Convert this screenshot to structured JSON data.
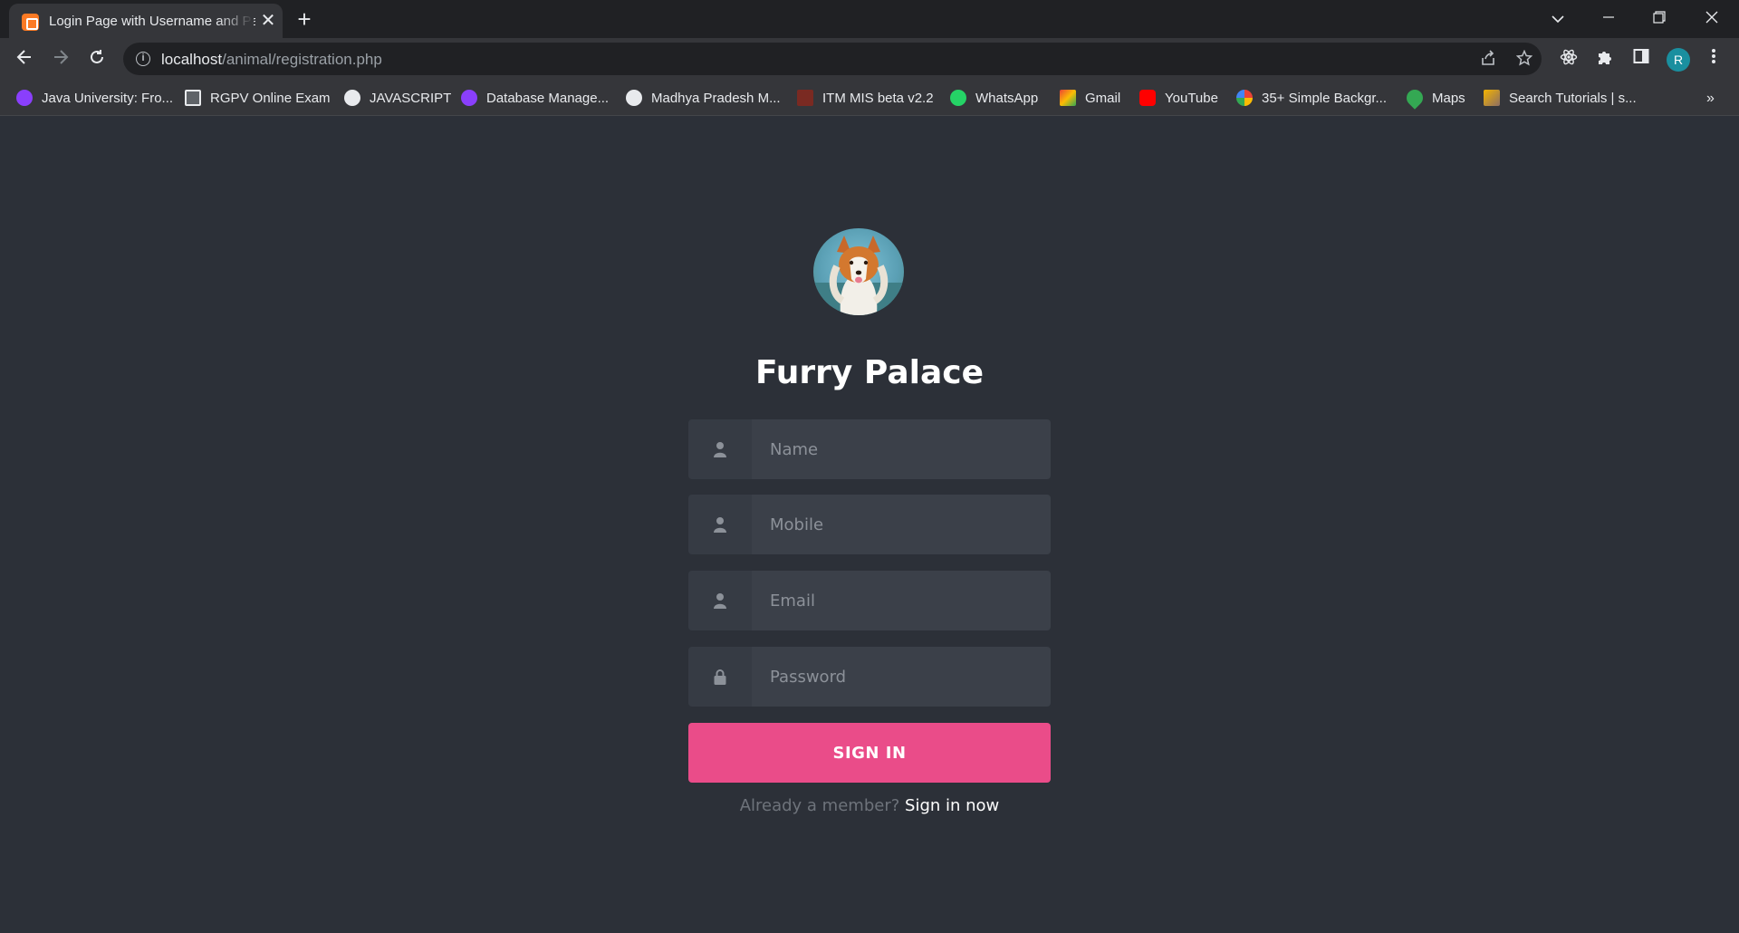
{
  "browser": {
    "tab_title": "Login Page with Username and Password",
    "tab_close": "✕",
    "new_tab": "+",
    "url_host": "localhost",
    "url_path": "/animal/registration.php",
    "profile_initial": "R",
    "bookmarks_more": "»",
    "bookmarks": [
      {
        "label": "Java University: Fro...",
        "icon": "purple-u-icon",
        "color": "#8a3ffc"
      },
      {
        "label": "RGPV Online Exam",
        "icon": "page-icon",
        "color": "#e8eaed"
      },
      {
        "label": "JAVASCRIPT",
        "icon": "globe-icon",
        "color": "#e8eaed"
      },
      {
        "label": "Database Manage...",
        "icon": "purple-u-icon",
        "color": "#8a3ffc"
      },
      {
        "label": "Madhya Pradesh M...",
        "icon": "globe-icon",
        "color": "#e8eaed"
      },
      {
        "label": "ITM MIS beta v2.2",
        "icon": "itm-icon",
        "color": "#c0392b"
      },
      {
        "label": "WhatsApp",
        "icon": "whatsapp-icon",
        "color": "#25d366"
      },
      {
        "label": "Gmail",
        "icon": "gmail-icon",
        "color": "#ea4335"
      },
      {
        "label": "YouTube",
        "icon": "youtube-icon",
        "color": "#ff0000"
      },
      {
        "label": "35+ Simple Backgr...",
        "icon": "google-icon",
        "color": "#4285f4"
      },
      {
        "label": "Maps",
        "icon": "maps-icon",
        "color": "#34a853"
      },
      {
        "label": "Search Tutorials | s...",
        "icon": "tutorials-icon",
        "color": "#f4b400"
      }
    ]
  },
  "page": {
    "title": "Furry Palace",
    "fields": [
      {
        "placeholder": "Name",
        "icon": "person-icon"
      },
      {
        "placeholder": "Mobile",
        "icon": "person-icon"
      },
      {
        "placeholder": "Email",
        "icon": "person-icon"
      },
      {
        "placeholder": "Password",
        "icon": "lock-icon"
      }
    ],
    "submit_label": "SIGN IN",
    "footer_prefix": "Already a member?",
    "footer_link": "Sign in now"
  }
}
